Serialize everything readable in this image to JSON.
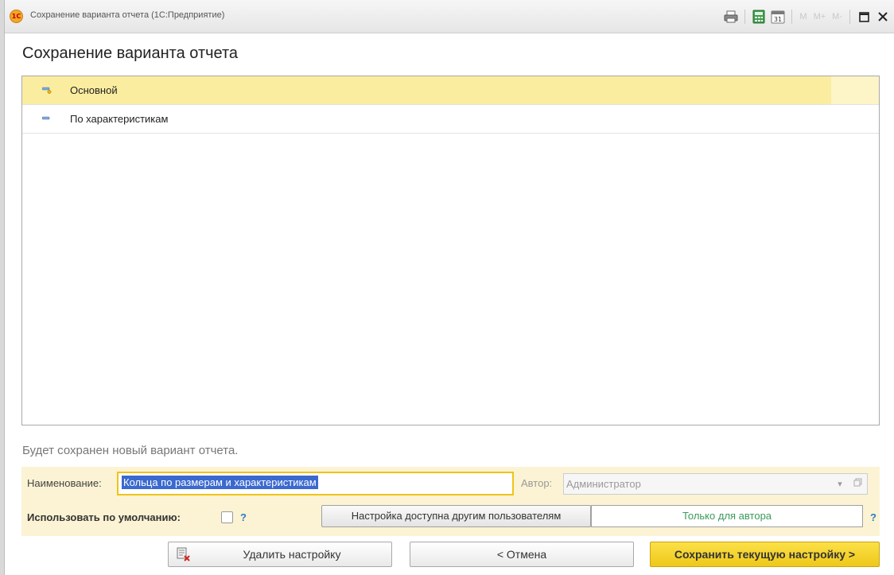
{
  "window": {
    "title": "Сохранение варианта отчета  (1С:Предприятие)",
    "logo_text": "1С",
    "toolbar": {
      "mem_m": "M",
      "mem_mplus": "M+",
      "mem_mminus": "M-",
      "calendar_day": "31"
    }
  },
  "page": {
    "title": "Сохранение варианта отчета"
  },
  "variants": [
    {
      "label": "Основной",
      "selected": true
    },
    {
      "label": "По характеристикам",
      "selected": false
    }
  ],
  "info_text": "Будет сохранен новый вариант отчета.",
  "form": {
    "name_label": "Наименование:",
    "name_value": "Кольца по размерам и характеристикам",
    "author_label": "Автор:",
    "author_value": "Администратор",
    "default_label": "Использовать по умолчанию:",
    "default_checked": false,
    "help": "?",
    "share_button": "Настройка доступна другим пользователям",
    "share_value": "Только для автора"
  },
  "buttons": {
    "delete": "Удалить настройку",
    "cancel": "< Отмена",
    "save": "Сохранить текущую настройку >"
  },
  "colors": {
    "selected_row": "#fbeda0",
    "form_panel": "#fbf3d3",
    "accent_button": "#f5d42c",
    "link_blue": "#2c7bc4",
    "share_value_text": "#3a9a5b"
  }
}
